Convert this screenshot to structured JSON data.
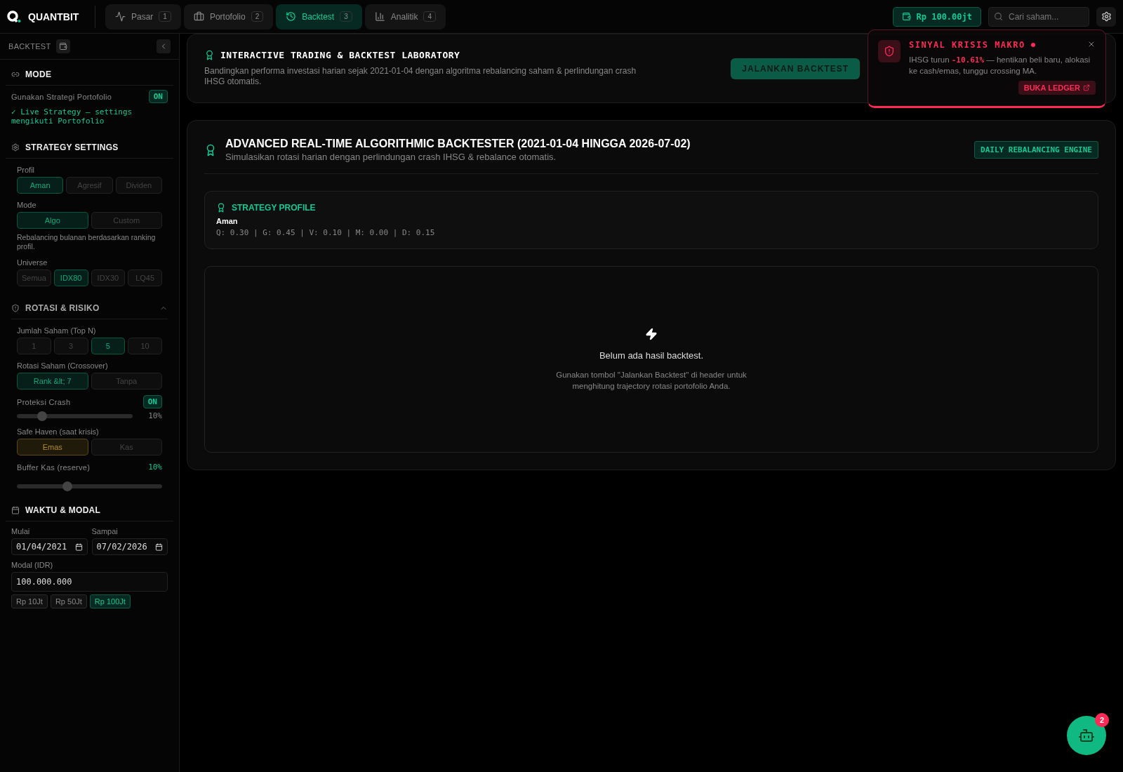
{
  "header": {
    "logo": "QUANTBIT",
    "tabs": [
      {
        "label": "Pasar",
        "badge": "1",
        "selected": false
      },
      {
        "label": "Portofolio",
        "badge": "2",
        "selected": false
      },
      {
        "label": "Backtest",
        "badge": "3",
        "selected": true
      },
      {
        "label": "Analitik",
        "badge": "4",
        "selected": false
      }
    ],
    "balance": "Rp 100.00jt",
    "search": {
      "placeholder": "Cari saham..."
    }
  },
  "sidebar": {
    "title": "BACKTEST",
    "mode": {
      "title": "MODE",
      "toggle_label": "Gunakan Strategi Portofolio",
      "toggle_on": true,
      "toggle_text": "ON",
      "note": "✓ Live Strategy — settings mengikuti Portofolio"
    },
    "strategy": {
      "title": "STRATEGY SETTINGS",
      "groups": [
        {
          "label": "Profil",
          "options": [
            {
              "label": "Aman",
              "selected": true
            },
            {
              "label": "Agresif",
              "selected": false
            },
            {
              "label": "Dividen",
              "selected": false
            }
          ]
        },
        {
          "label": "Mode",
          "options": [
            {
              "label": "Algo",
              "selected": true
            },
            {
              "label": "Custom",
              "selected": false
            }
          ],
          "note": "Rebalancing bulanan berdasarkan ranking profil."
        },
        {
          "label": "Universe",
          "options": [
            {
              "label": "Semua",
              "selected": false
            },
            {
              "label": "IDX80",
              "selected": true
            },
            {
              "label": "IDX30",
              "selected": false
            },
            {
              "label": "LQ45",
              "selected": false
            }
          ]
        }
      ]
    },
    "risk": {
      "title": "ROTASI & RISIKO",
      "expanded": true,
      "top_n": {
        "label": "Jumlah Saham (Top N)",
        "options": [
          {
            "label": "1",
            "selected": false
          },
          {
            "label": "3",
            "selected": false
          },
          {
            "label": "5",
            "selected": true
          },
          {
            "label": "10",
            "selected": false
          }
        ]
      },
      "rotation": {
        "label": "Rotasi Saham (Crossover)",
        "options": [
          {
            "label": "Rank &lt; 7",
            "selected": true
          },
          {
            "label": "Tanpa",
            "selected": false
          }
        ]
      },
      "crash": {
        "label": "Proteksi Crash",
        "on": true,
        "toggle_text": "ON",
        "level": 0.22,
        "reading": "10%"
      },
      "safe_haven": {
        "label": "Safe Haven (saat krisis)",
        "options": [
          {
            "label": "Emas",
            "selected": true
          },
          {
            "label": "Kas",
            "selected": false
          }
        ]
      },
      "buffer": {
        "label": "Buffer Kas (reserve)",
        "reading": "10%",
        "level": 0.35
      }
    },
    "time": {
      "title": "WAKTU & MODAL",
      "start_label": "Mulai",
      "start": "01/04/2021",
      "end_label": "Sampai",
      "end": "07/02/2026",
      "capital_label": "Modal (IDR)",
      "capital": "100.000.000",
      "presets": [
        {
          "label": "Rp 10Jt",
          "selected": false
        },
        {
          "label": "Rp 50Jt",
          "selected": false
        },
        {
          "label": "Rp 100Jt",
          "selected": true
        }
      ]
    }
  },
  "lab": {
    "title": "INTERACTIVE TRADING & BACKTEST LABORATORY",
    "subtitle": "Bandingkan performa investasi harian sejak 2021-01-04 dengan algoritma rebalancing saham & perlindungan crash IHSG otomatis.",
    "run_button": "JALANKAN BACKTEST"
  },
  "backtester": {
    "title": "ADVANCED REAL-TIME ALGORITHMIC BACKTESTER (2021-01-04 HINGGA 2026-07-02)",
    "subtitle": "Simulasikan rotasi harian dengan perlindungan crash IHSG & rebalance otomatis.",
    "badge": "DAILY REBALANCING ENGINE",
    "profile": {
      "title": "STRATEGY PROFILE",
      "name": "Aman",
      "weights": "Q: 0.30 | G: 0.45 | V: 0.10 | M: 0.00 | D: 0.15"
    },
    "empty": {
      "title": "Belum ada hasil backtest.",
      "text": "Gunakan tombol \"Jalankan Backtest\" di header untuk menghitung trajectory rotasi portofolio Anda."
    }
  },
  "alert": {
    "title": "SINYAL KRISIS MAKRO",
    "text_before": "IHSG turun ",
    "value": "-10.61%",
    "text_after": " — hentikan beli baru, alokasi ke cash/emas, tunggu crossing MA.",
    "action": "BUKA LEDGER"
  },
  "assistant": {
    "badge": "2"
  }
}
